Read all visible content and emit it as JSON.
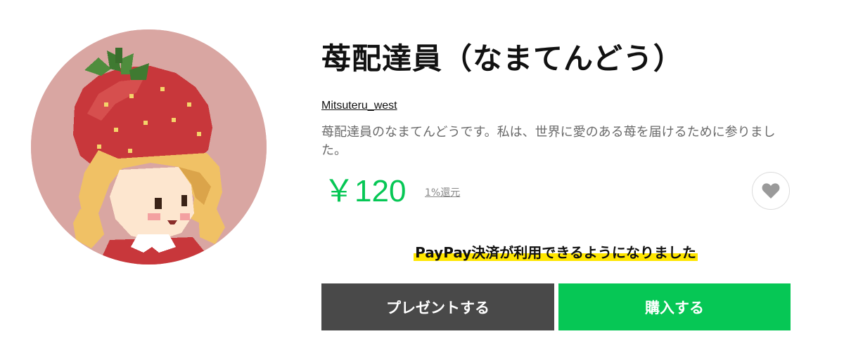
{
  "sticker": {
    "title": "苺配達員（なまてんどう）",
    "author": "Mitsuteru_west",
    "description": "苺配達員のなまてんどうです。私は、世界に愛のある苺を届けるために参りました。",
    "price": "￥120",
    "points_label": "1%還元",
    "favorite_icon": "heart-icon",
    "avatar_icon": "strawberry-girl-pixel-art"
  },
  "notice": {
    "paypay_text": "PayPay決済が利用できるようになりました"
  },
  "actions": {
    "present_label": "プレゼントする",
    "buy_label": "購入する"
  },
  "colors": {
    "accent_green": "#06c755",
    "present_button": "#494949",
    "highlight_yellow": "#ffe600"
  }
}
